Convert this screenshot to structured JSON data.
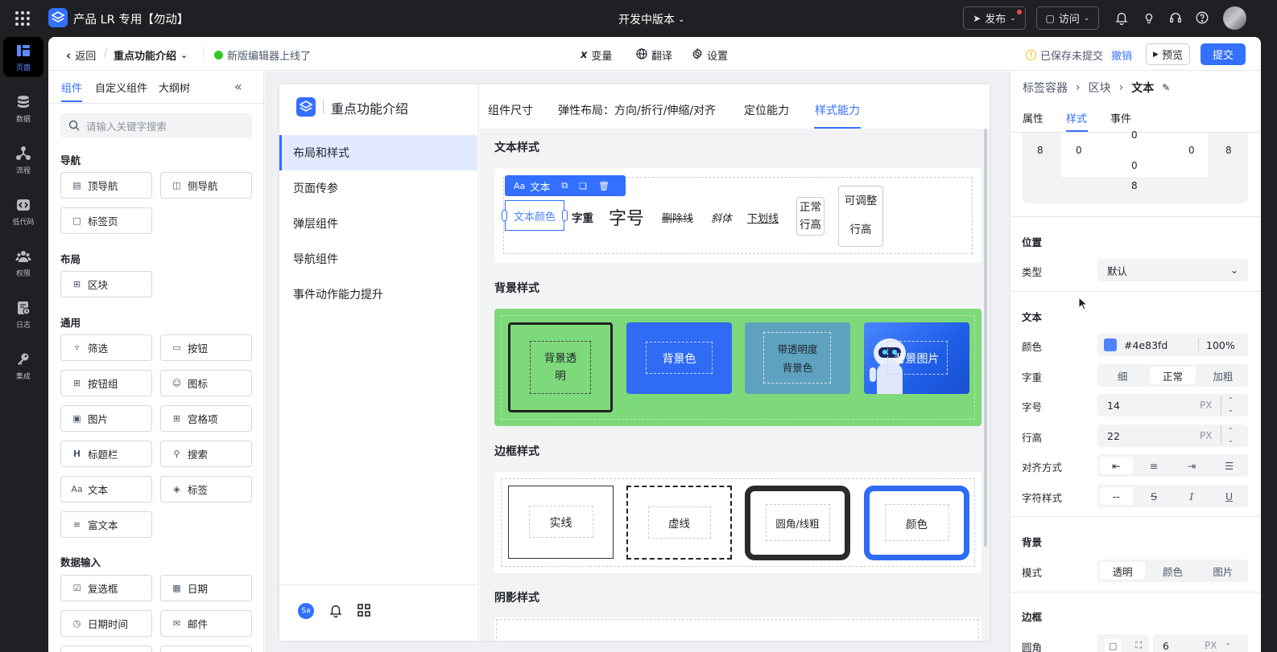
{
  "topbar": {
    "app_name": "产品 LR 专用【勿动】",
    "version_label": "开发中版本",
    "publish_label": "发布",
    "visit_label": "访问"
  },
  "rail": [
    {
      "label": "页面",
      "icon": "page-icon"
    },
    {
      "label": "数据",
      "icon": "database-icon"
    },
    {
      "label": "流程",
      "icon": "flow-icon"
    },
    {
      "label": "低代码",
      "icon": "code-icon"
    },
    {
      "label": "权限",
      "icon": "users-icon"
    },
    {
      "label": "日志",
      "icon": "log-icon"
    },
    {
      "label": "集成",
      "icon": "key-icon"
    }
  ],
  "subbar": {
    "back_label": "返回",
    "page_name": "重点功能介绍",
    "notice": "新版编辑器上线了",
    "var_label": "变量",
    "translate_label": "翻译",
    "settings_label": "设置",
    "save_status": "已保存未提交",
    "undo_label": "撤销",
    "preview_label": "预览",
    "submit_label": "提交"
  },
  "comp_panel": {
    "tabs": [
      "组件",
      "自定义组件",
      "大纲树"
    ],
    "search_placeholder": "请输入关键字搜索",
    "sections": {
      "nav": "导航",
      "layout": "布局",
      "general": "通用",
      "input": "数据输入"
    },
    "items": {
      "top_nav": "顶导航",
      "side_nav": "侧导航",
      "tab_page": "标签页",
      "block": "区块",
      "filter": "筛选",
      "button": "按钮",
      "button_group": "按钮组",
      "icon": "图标",
      "image": "图片",
      "grid_item": "宫格项",
      "title_bar": "标题栏",
      "search": "搜索",
      "text": "文本",
      "tag": "标签",
      "rich_text": "富文本",
      "checkbox": "复选框",
      "date": "日期",
      "datetime": "日期时间",
      "email": "邮件"
    }
  },
  "app": {
    "title": "重点功能介绍",
    "nav": [
      "布局和样式",
      "页面传参",
      "弹层组件",
      "导航组件",
      "事件动作能力提升"
    ],
    "avatar": "Sa",
    "tabs": [
      "组件尺寸",
      "弹性布局：方向/折行/伸缩/对齐",
      "定位能力",
      "样式能力"
    ],
    "text_section": "文本样式",
    "toolbar_label": "文本",
    "text_samples": {
      "color": "文本颜色",
      "weight": "字重",
      "size": "字号",
      "strike": "删除线",
      "italic": "斜体",
      "underline": "下划线",
      "normal_lh_1": "正常",
      "normal_lh_2": "行高",
      "adj_lh_1": "可调整",
      "adj_lh_2": "行高"
    },
    "bg_section": "背景样式",
    "bg_boxes": {
      "transparent_1": "背景透",
      "transparent_2": "明",
      "color": "背景色",
      "alpha_1": "带透明度",
      "alpha_2": "背景色",
      "image": "背景图片"
    },
    "border_section": "边框样式",
    "border_boxes": [
      "实线",
      "虚线",
      "圆角/线粗",
      "颜色"
    ],
    "shadow_section": "阴影样式"
  },
  "props": {
    "breadcrumb": [
      "标签容器",
      "区块",
      "文本"
    ],
    "tabs": [
      "属性",
      "样式",
      "事件"
    ],
    "spacing": {
      "margin_top": "0",
      "margin_bottom": "0",
      "left_outer": "8",
      "left_inner": "0",
      "right_inner": "0",
      "right_outer": "8",
      "bottom": "8"
    },
    "position_title": "位置",
    "type_label": "类型",
    "type_value": "默认",
    "text_title": "文本",
    "color_label": "颜色",
    "color_value": "#4e83fd",
    "color_swatch": "#4e83fd",
    "opacity_value": "100%",
    "weight_label": "字重",
    "weight_options": [
      "细",
      "正常",
      "加粗"
    ],
    "size_label": "字号",
    "size_value": "14",
    "line_height_label": "行高",
    "line_height_value": "22",
    "unit": "PX",
    "align_label": "对齐方式",
    "char_style_label": "字符样式",
    "char_none": "--",
    "bg_title": "背景",
    "mode_label": "模式",
    "mode_options": [
      "透明",
      "颜色",
      "图片"
    ],
    "border_title": "边框",
    "radius_label": "圆角",
    "radius_value": "6"
  },
  "colors": {
    "accent": "#3370ff",
    "green_bg": "#7dd97a",
    "blue_box": "#2f6bf5",
    "teal_box": "#5fa2c0"
  }
}
